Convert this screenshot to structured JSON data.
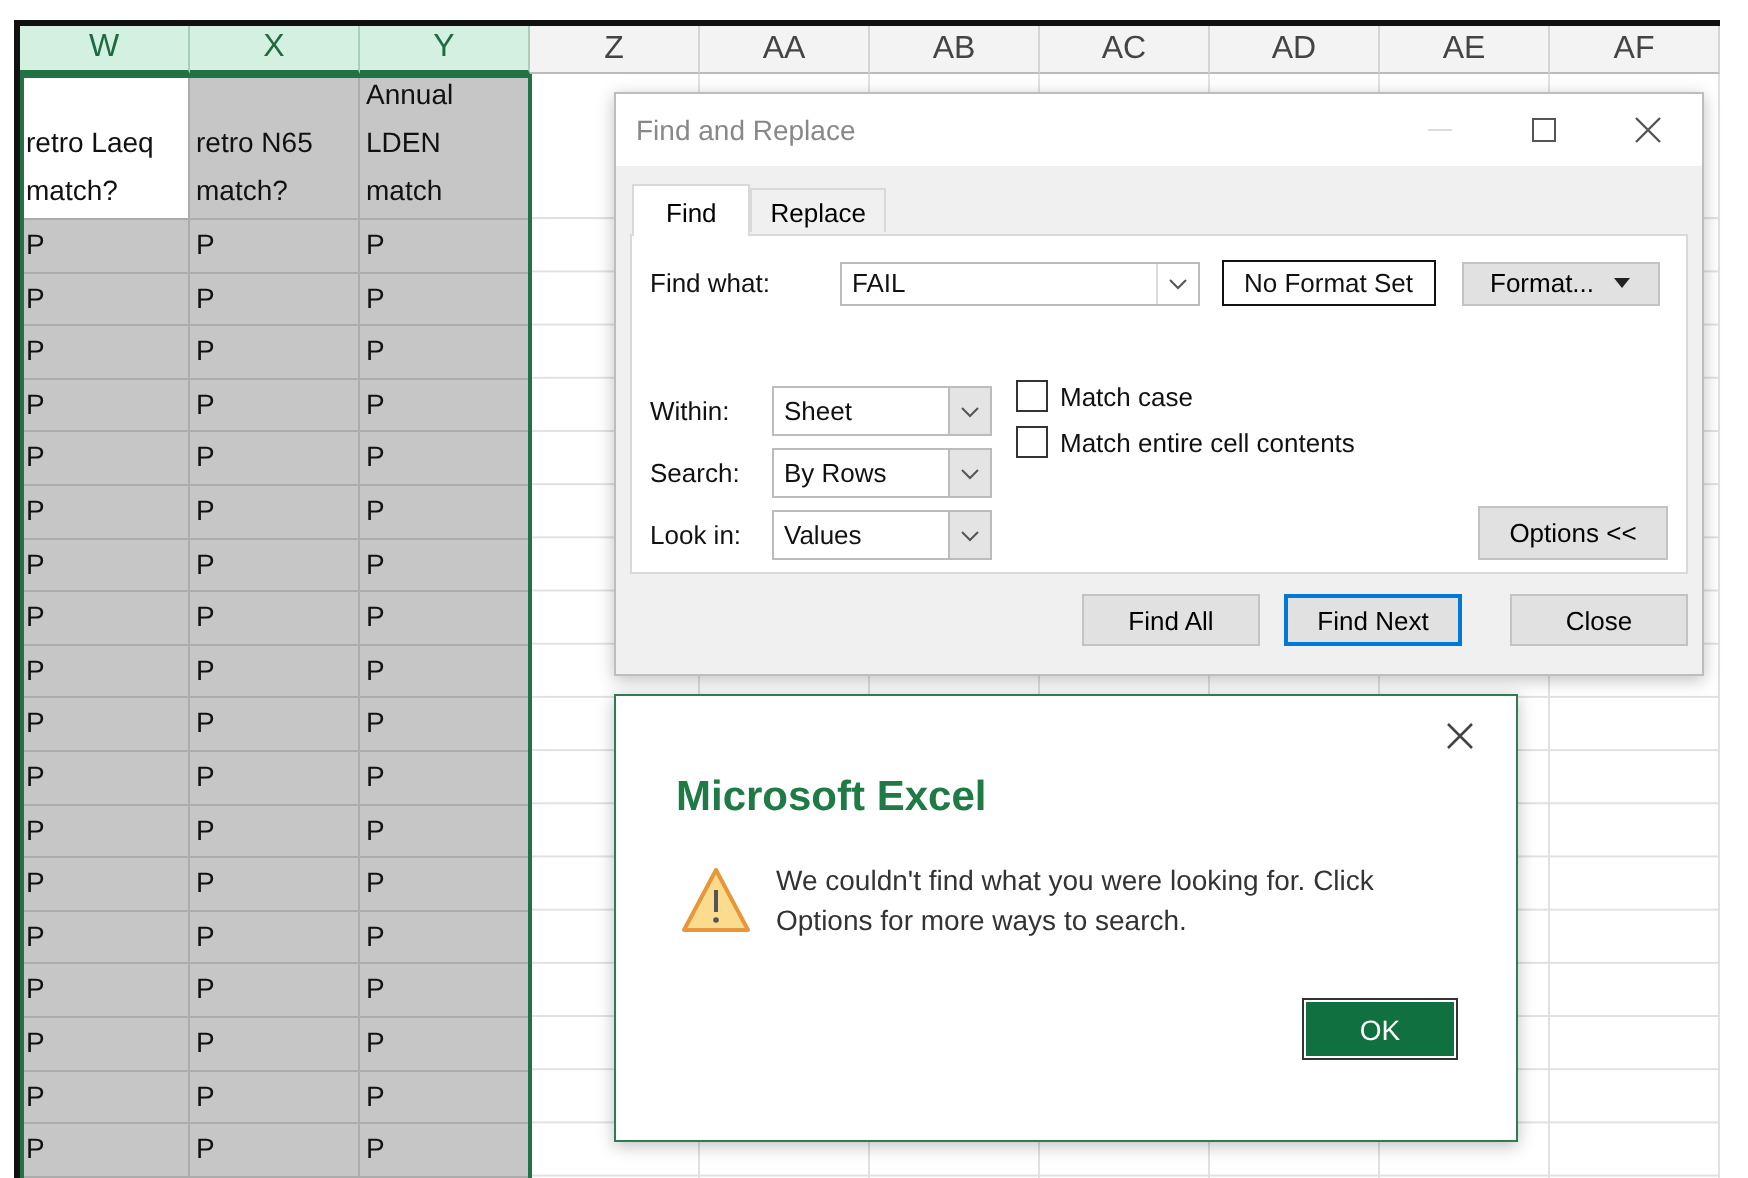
{
  "sheet": {
    "columns": [
      {
        "label": "W",
        "selected": true
      },
      {
        "label": "X",
        "selected": true
      },
      {
        "label": "Y",
        "selected": true
      },
      {
        "label": "Z",
        "selected": false
      },
      {
        "label": "AA",
        "selected": false
      },
      {
        "label": "AB",
        "selected": false
      },
      {
        "label": "AC",
        "selected": false
      },
      {
        "label": "AD",
        "selected": false
      },
      {
        "label": "AE",
        "selected": false
      },
      {
        "label": "AF",
        "selected": false
      }
    ],
    "header_cells": [
      {
        "lines": [
          "retro Laeq",
          "match?"
        ],
        "active": true
      },
      {
        "lines": [
          "retro N65",
          "match?"
        ],
        "active": false
      },
      {
        "lines": [
          "Annual",
          "LDEN",
          "match"
        ],
        "active": false
      }
    ],
    "rows": [
      [
        "P",
        "P",
        "P"
      ],
      [
        "P",
        "P",
        "P"
      ],
      [
        "P",
        "P",
        "P"
      ],
      [
        "P",
        "P",
        "P"
      ],
      [
        "P",
        "P",
        "P"
      ],
      [
        "P",
        "P",
        "P"
      ],
      [
        "P",
        "P",
        "P"
      ],
      [
        "P",
        "P",
        "P"
      ],
      [
        "P",
        "P",
        "P"
      ],
      [
        "P",
        "P",
        "P"
      ],
      [
        "P",
        "P",
        "P"
      ],
      [
        "P",
        "P",
        "P"
      ],
      [
        "P",
        "P",
        "P"
      ],
      [
        "P",
        "P",
        "P"
      ],
      [
        "P",
        "P",
        "P"
      ],
      [
        "P",
        "P",
        "P"
      ],
      [
        "P",
        "P",
        "P"
      ],
      [
        "P",
        "P",
        "P"
      ]
    ]
  },
  "find_dialog": {
    "title": "Find and Replace",
    "tabs": [
      {
        "label": "Find",
        "selected": true
      },
      {
        "label": "Replace",
        "selected": false
      }
    ],
    "find_what": {
      "label": "Find what:",
      "value": "FAIL"
    },
    "format_preview": "No Format Set",
    "format_button": "Format...",
    "dropdowns": [
      {
        "label": "Within:",
        "value": "Sheet"
      },
      {
        "label": "Search:",
        "value": "By Rows"
      },
      {
        "label": "Look in:",
        "value": "Values"
      }
    ],
    "checkboxes": [
      {
        "label": "Match case",
        "checked": false
      },
      {
        "label": "Match entire cell contents",
        "checked": false
      }
    ],
    "options_button": "Options <<",
    "buttons": [
      {
        "label": "Find All",
        "focused": false
      },
      {
        "label": "Find Next",
        "focused": true
      },
      {
        "label": "Close",
        "focused": false
      }
    ]
  },
  "alert": {
    "title": "Microsoft Excel",
    "message": "We couldn't find what you were looking for. Click Options for more ways to search.",
    "ok": "OK"
  }
}
